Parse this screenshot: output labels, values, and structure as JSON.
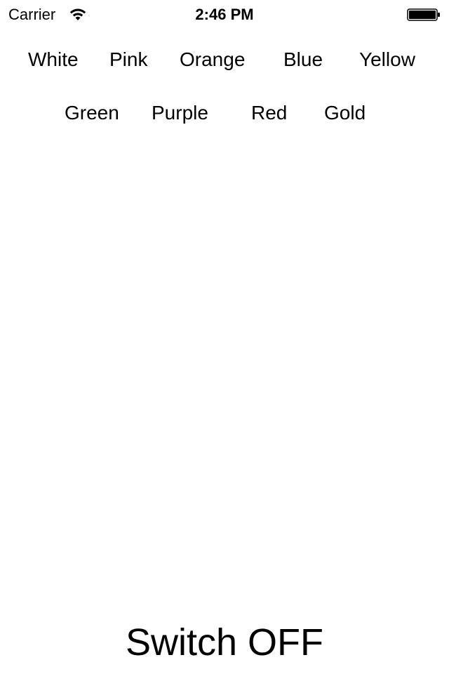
{
  "status_bar": {
    "carrier": "Carrier",
    "time": "2:46 PM",
    "wifi_icon": "wifi-icon",
    "battery_icon": "battery-icon"
  },
  "color_buttons": {
    "row1": [
      "White",
      "Pink",
      "Orange",
      "Blue",
      "Yellow"
    ],
    "row2": [
      "Green",
      "Purple",
      "Red",
      "Gold"
    ]
  },
  "switch_label": "Switch OFF",
  "colors": {
    "background": "#ffffff",
    "text": "#000000"
  }
}
